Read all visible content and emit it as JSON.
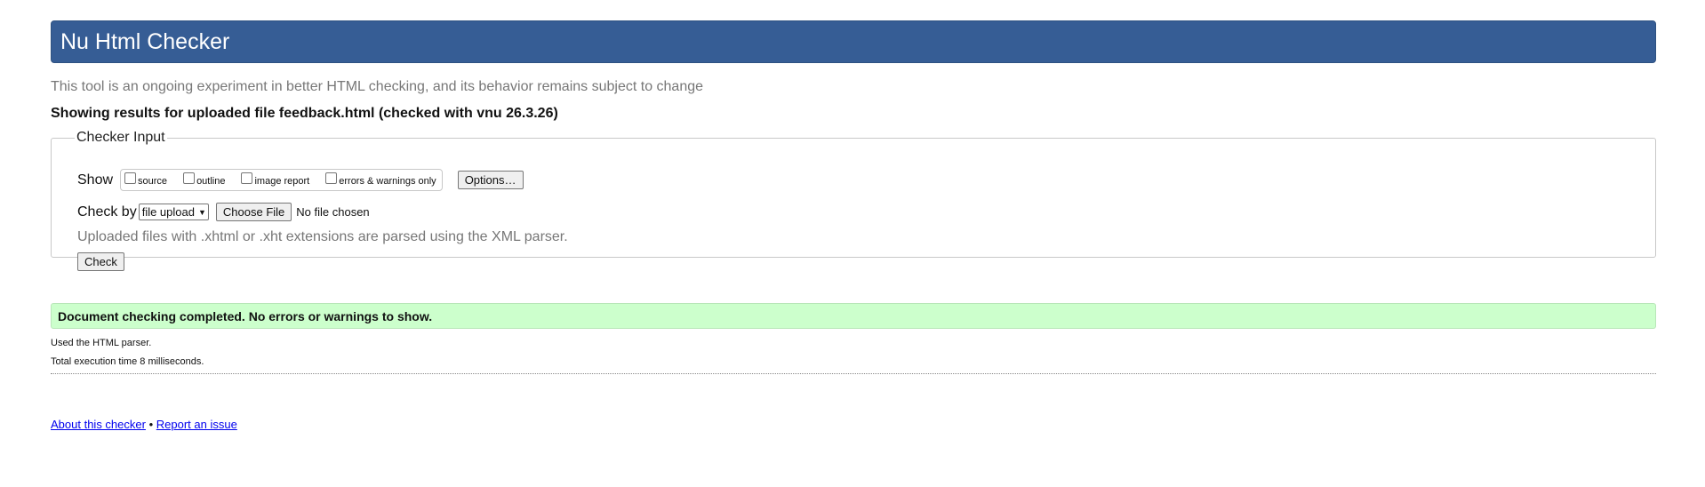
{
  "header": {
    "title": "Nu Html Checker"
  },
  "intro": "This tool is an ongoing experiment in better HTML checking, and its behavior remains subject to change",
  "results_heading": "Showing results for uploaded file feedback.html (checked with vnu 26.3.26)",
  "checker_input": {
    "legend": "Checker Input",
    "show_label": "Show",
    "show_options": [
      {
        "label": "source",
        "checked": false
      },
      {
        "label": "outline",
        "checked": false
      },
      {
        "label": "image report",
        "checked": false
      },
      {
        "label": "errors & warnings only",
        "checked": false
      }
    ],
    "options_button": "Options…",
    "check_by_label": "Check by",
    "check_by_selected": "file upload",
    "choose_file_button": "Choose File",
    "no_file_text": "No file chosen",
    "xml_note": "Uploaded files with .xhtml or .xht extensions are parsed using the XML parser.",
    "check_button": "Check"
  },
  "result": {
    "success_message": "Document checking completed. No errors or warnings to show.",
    "parser_line": "Used the HTML parser.",
    "time_line": "Total execution time 8 milliseconds."
  },
  "footer": {
    "about_link": "About this checker",
    "separator": "•",
    "report_link": "Report an issue"
  },
  "colors": {
    "header_bg": "#365d95",
    "success_bg": "#ccffcc",
    "muted_text": "#777777",
    "link": "#0000ee"
  }
}
